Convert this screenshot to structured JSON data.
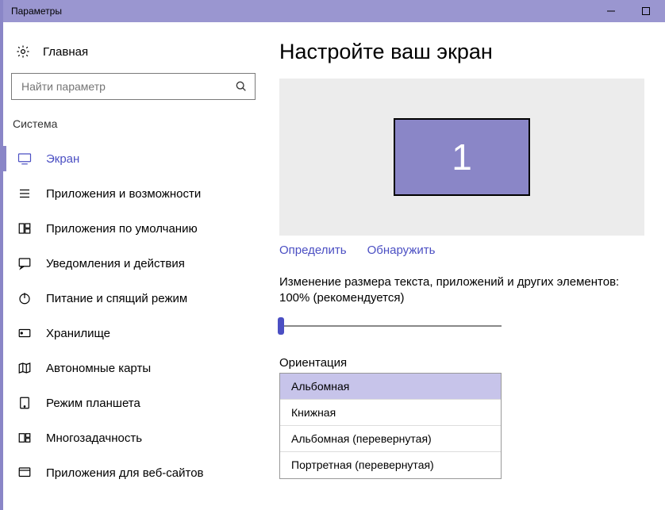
{
  "window": {
    "title": "Параметры"
  },
  "sidebar": {
    "home": "Главная",
    "search_placeholder": "Найти параметр",
    "category": "Система",
    "items": [
      {
        "label": "Экран"
      },
      {
        "label": "Приложения и возможности"
      },
      {
        "label": "Приложения по умолчанию"
      },
      {
        "label": "Уведомления и действия"
      },
      {
        "label": "Питание и спящий режим"
      },
      {
        "label": "Хранилище"
      },
      {
        "label": "Автономные карты"
      },
      {
        "label": "Режим планшета"
      },
      {
        "label": "Многозадачность"
      },
      {
        "label": "Приложения для веб-сайтов"
      }
    ]
  },
  "main": {
    "title": "Настройте ваш экран",
    "monitor_number": "1",
    "identify": "Определить",
    "detect": "Обнаружить",
    "scale_text": "Изменение размера текста, приложений и других элементов: 100% (рекомендуется)",
    "orientation_label": "Ориентация",
    "orientation_options": [
      "Альбомная",
      "Книжная",
      "Альбомная (перевернутая)",
      "Портретная (перевернутая)"
    ]
  }
}
